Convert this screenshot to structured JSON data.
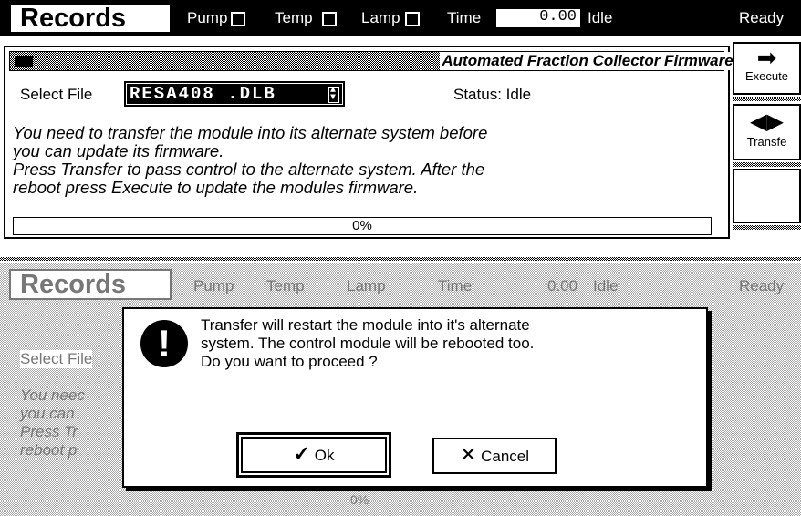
{
  "topbar": {
    "title": "Records",
    "pump_label": "Pump",
    "temp_label": "Temp",
    "lamp_label": "Lamp",
    "time_label": "Time",
    "time_value": "0.00",
    "idle_text": "Idle",
    "ready_text": "Ready"
  },
  "panel": {
    "title": "Automated Fraction Collector Firmware Update",
    "select_label": "Select File",
    "selected_file": "RESA408 .DLB",
    "status_text": "Status: Idle",
    "message_lines": [
      "You need to transfer the module into its alternate system before",
      "you can update its firmware.",
      "Press Transfer to pass control to the alternate system. After the",
      "reboot press Execute to update the modules firmware."
    ],
    "progress_text": "0%",
    "progress_fraction": 0
  },
  "side_buttons": {
    "execute": "Execute",
    "transfer": "Transfe"
  },
  "dialog": {
    "message_lines": [
      "Transfer will restart the module into it's alternate",
      "system. The control module will be rebooted too.",
      "Do you want to proceed ?"
    ],
    "ok_label": "Ok",
    "cancel_label": "Cancel"
  },
  "background_screen": {
    "title": "Records",
    "pump_label": "Pump",
    "temp_label": "Temp",
    "lamp_label": "Lamp",
    "time_label": "Time",
    "time_value": "0.00",
    "idle_text": "Idle",
    "ready_text": "Ready",
    "select_label": "Select File",
    "message_fragments": [
      "You neec",
      "you can",
      "Press Tr",
      "reboot p"
    ],
    "progress_text": "0%"
  }
}
